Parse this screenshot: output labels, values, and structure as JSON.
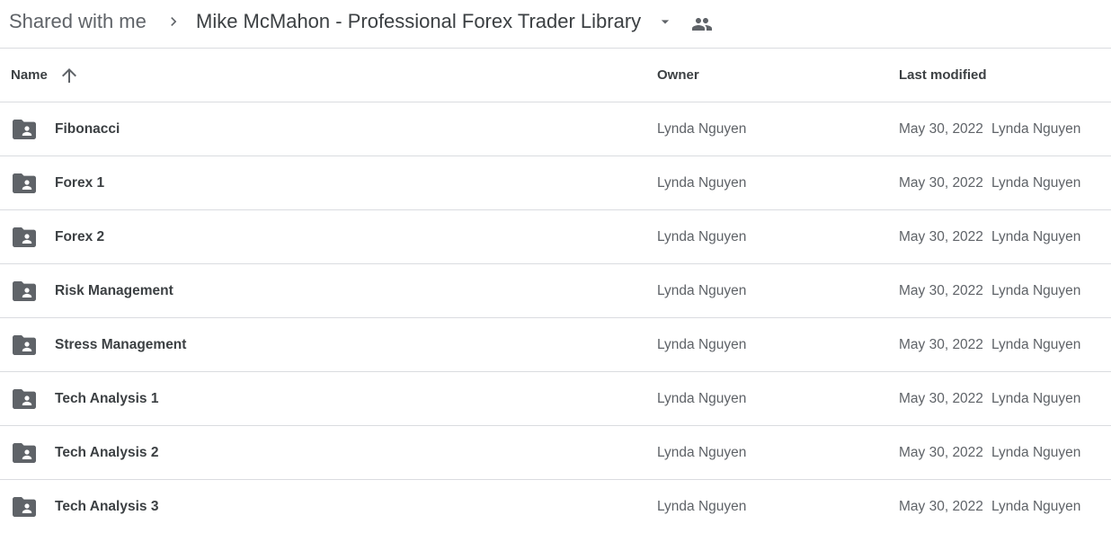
{
  "breadcrumb": {
    "root": "Shared with me",
    "current": "Mike McMahon - Professional Forex Trader Library"
  },
  "columns": {
    "name": "Name",
    "owner": "Owner",
    "last_modified": "Last modified"
  },
  "icons": {
    "separator": "chevron-right-icon",
    "dropdown": "arrow-drop-down-icon",
    "shared": "people-icon",
    "sort": "arrow-upward-icon",
    "folder": "shared-folder-icon"
  },
  "colors": {
    "icon": "#5f6368",
    "divider": "#dadce0"
  },
  "rows": [
    {
      "name": "Fibonacci",
      "owner": "Lynda Nguyen",
      "modified_date": "May 30, 2022",
      "modified_by": "Lynda Nguyen"
    },
    {
      "name": "Forex 1",
      "owner": "Lynda Nguyen",
      "modified_date": "May 30, 2022",
      "modified_by": "Lynda Nguyen"
    },
    {
      "name": "Forex 2",
      "owner": "Lynda Nguyen",
      "modified_date": "May 30, 2022",
      "modified_by": "Lynda Nguyen"
    },
    {
      "name": "Risk Management",
      "owner": "Lynda Nguyen",
      "modified_date": "May 30, 2022",
      "modified_by": "Lynda Nguyen"
    },
    {
      "name": "Stress Management",
      "owner": "Lynda Nguyen",
      "modified_date": "May 30, 2022",
      "modified_by": "Lynda Nguyen"
    },
    {
      "name": "Tech Analysis 1",
      "owner": "Lynda Nguyen",
      "modified_date": "May 30, 2022",
      "modified_by": "Lynda Nguyen"
    },
    {
      "name": "Tech Analysis 2",
      "owner": "Lynda Nguyen",
      "modified_date": "May 30, 2022",
      "modified_by": "Lynda Nguyen"
    },
    {
      "name": "Tech Analysis 3",
      "owner": "Lynda Nguyen",
      "modified_date": "May 30, 2022",
      "modified_by": "Lynda Nguyen"
    }
  ]
}
